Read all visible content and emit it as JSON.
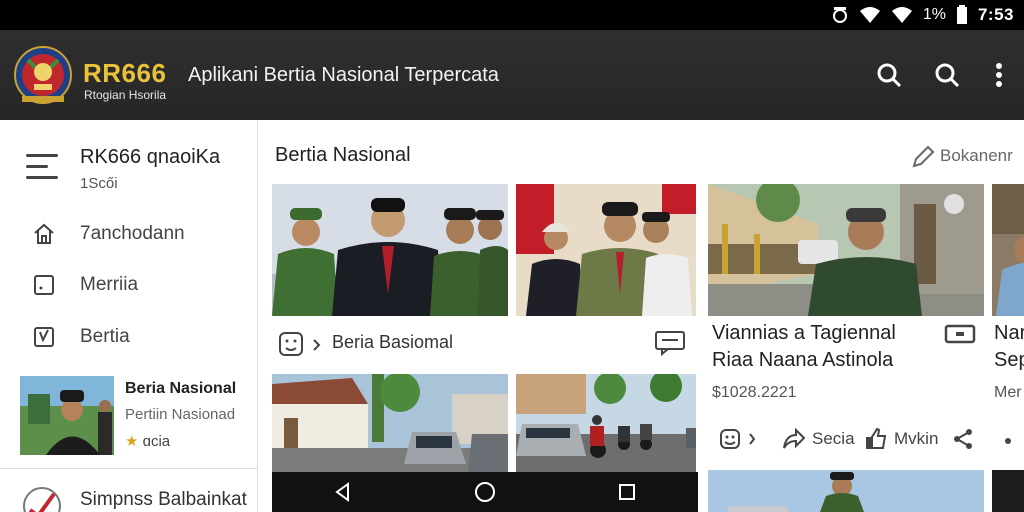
{
  "status_bar": {
    "battery": "1%",
    "time": "7:53"
  },
  "app_bar": {
    "brand": "RR666",
    "brand_sub": "Rtogian Hsorila",
    "title": "Aplikani Bertia Nasional Terpercata",
    "icons": [
      "search-icon",
      "search-icon",
      "more-vert-icon"
    ]
  },
  "sidebar": {
    "header_title": "RK666  qnaoiKa",
    "header_sub": "1Scői",
    "items": [
      {
        "label": "7anchodann",
        "icon": "home-icon"
      },
      {
        "label": "Merriia",
        "icon": "square-icon"
      },
      {
        "label": "Bertia",
        "icon": "checkbox-icon"
      }
    ],
    "card": {
      "title": "Beria Nasional",
      "subtitle": "Pertiin Nasionad",
      "meta": "ɑcia"
    },
    "bottom_label": "Simpnss Balbainkat"
  },
  "main": {
    "section_title": "Bertia Nasional",
    "section_action": "Bokanenr",
    "card_bar_label": "Beria Basiomal",
    "featured": {
      "title_line1": "Viannias a Tagiennal",
      "title_line2": "Riaa Naana Astinola",
      "date": "$1028.2221",
      "actions": {
        "share_label": "Secia",
        "like_label": "Mvkin"
      }
    },
    "edge_text": {
      "line1": "Nar",
      "line2": "Sep",
      "line3": "Mer"
    }
  },
  "colors": {
    "brand_accent": "#e9c23a",
    "app_bar": "#2b2b2b",
    "status_bar": "#000000"
  }
}
